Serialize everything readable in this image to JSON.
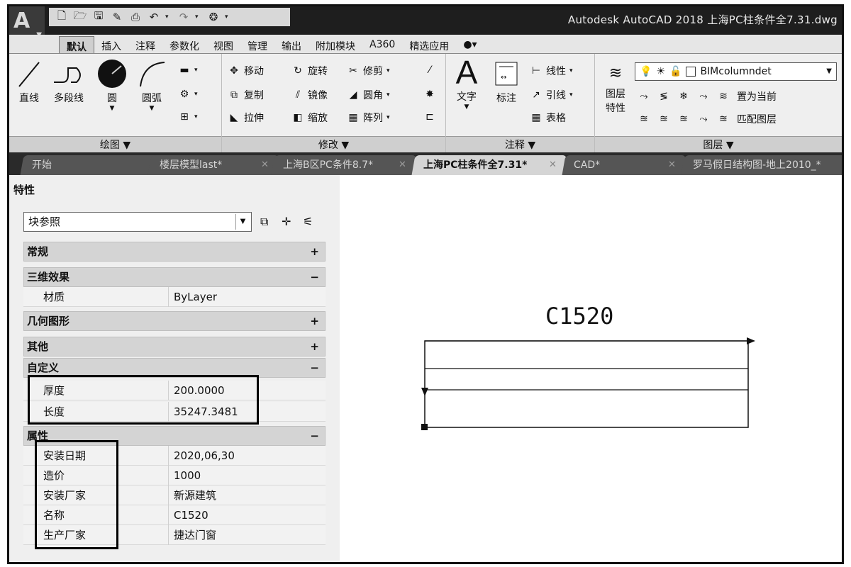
{
  "app": {
    "logo": "A",
    "title": "Autodesk AutoCAD 2018    上海PC柱条件全7.31.dwg"
  },
  "ribbon_tabs": [
    "默认",
    "插入",
    "注释",
    "参数化",
    "视图",
    "管理",
    "输出",
    "附加模块",
    "A360",
    "精选应用"
  ],
  "ribbon": {
    "draw": {
      "tools": [
        "直线",
        "多段线",
        "圆",
        "圆弧"
      ],
      "footer": "绘图 ▼"
    },
    "modify": {
      "rows": [
        [
          "移动",
          "旋转",
          "修剪"
        ],
        [
          "复制",
          "镜像",
          "圆角"
        ],
        [
          "拉伸",
          "缩放",
          "阵列"
        ]
      ],
      "footer": "修改 ▼"
    },
    "annotation": {
      "text": "文字",
      "dimension": "标注",
      "linear": "线性",
      "leader": "引线",
      "table": "表格",
      "footer": "注释 ▼"
    },
    "layers": {
      "layer_props_1": "图层",
      "layer_props_2": "特性",
      "current_layer": "BIMcolumndet",
      "set_current": "置为当前",
      "match_layer": "匹配图层",
      "footer": "图层 ▼"
    }
  },
  "doc_tabs": [
    {
      "label": "开始",
      "closable": false
    },
    {
      "label": "楼层模型last*",
      "closable": true
    },
    {
      "label": "上海B区PC条件8.7*",
      "closable": true
    },
    {
      "label": "上海PC柱条件全7.31*",
      "closable": true,
      "active": true
    },
    {
      "label": "CAD*",
      "closable": true
    },
    {
      "label": "罗马假日结构图-地上2010_*",
      "closable": false
    }
  ],
  "properties": {
    "title": "特性",
    "object_type": "块参照",
    "sections": {
      "general": {
        "label": "常规",
        "toggle": "+"
      },
      "effects3d": {
        "label": "三维效果",
        "toggle": "−"
      },
      "geometry": {
        "label": "几何图形",
        "toggle": "+"
      },
      "misc": {
        "label": "其他",
        "toggle": "+"
      },
      "custom": {
        "label": "自定义",
        "toggle": "−"
      },
      "attributes": {
        "label": "属性",
        "toggle": "−"
      }
    },
    "material": {
      "key": "材质",
      "value": "ByLayer"
    },
    "custom_rows": [
      {
        "key": "厚度",
        "value": "200.0000"
      },
      {
        "key": "长度",
        "value": "35247.3481"
      }
    ],
    "attribute_rows": [
      {
        "key": "安装日期",
        "value": "2020,06,30"
      },
      {
        "key": "造价",
        "value": "1000"
      },
      {
        "key": "安装厂家",
        "value": "新源建筑"
      },
      {
        "key": "名称",
        "value": "C1520"
      },
      {
        "key": "生产厂家",
        "value": "捷达门窗"
      }
    ]
  },
  "drawing": {
    "label": "C1520"
  }
}
